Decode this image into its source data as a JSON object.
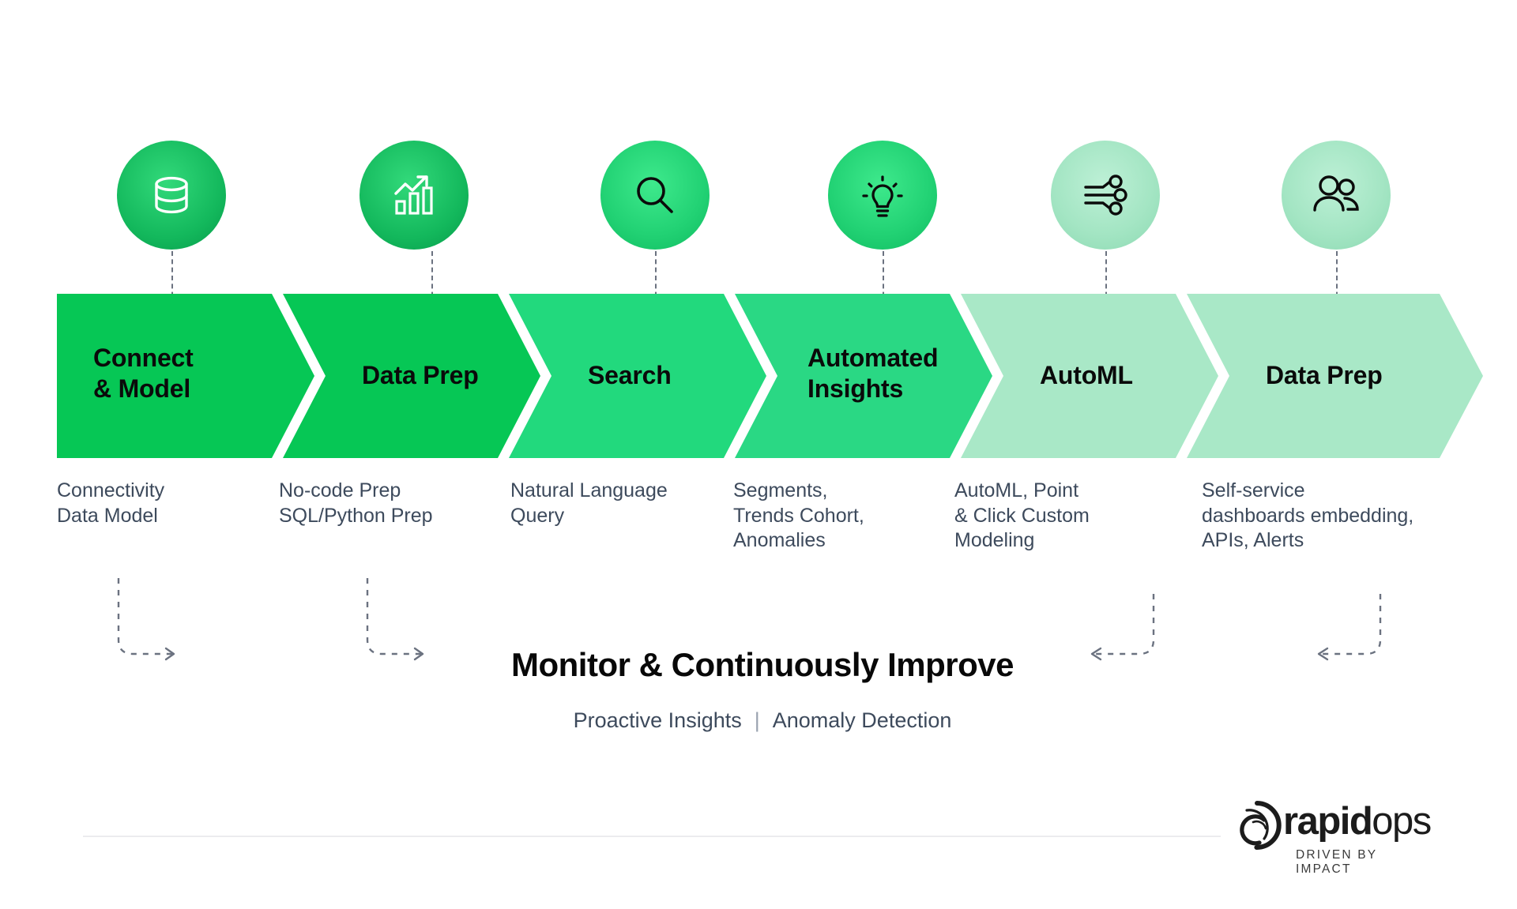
{
  "theme": {
    "green_dark": "#06c755",
    "green_mid": "#2ed47e",
    "green_light": "#a8e6c4",
    "green_pale": "#a9e8c7",
    "caption_color": "#3d4a5c",
    "arrow_color": "#6b7280",
    "divider_color": "#ececee"
  },
  "icons": [
    {
      "name": "database-icon",
      "stroke": "#ffffff",
      "circle_from": "#26d06e",
      "circle_to": "#0aa44b"
    },
    {
      "name": "bar-chart-growth-icon",
      "stroke": "#ffffff",
      "circle_from": "#2bd873",
      "circle_to": "#0aa44b"
    },
    {
      "name": "search-icon",
      "stroke": "#0b0b0b",
      "circle_from": "#3ce589",
      "circle_to": "#17c265"
    },
    {
      "name": "lightbulb-idea-icon",
      "stroke": "#0b0b0b",
      "circle_from": "#3ce589",
      "circle_to": "#17c265"
    },
    {
      "name": "model-nodes-icon",
      "stroke": "#0b0b0b",
      "circle_from": "#b6ecd0",
      "circle_to": "#8fdcb5"
    },
    {
      "name": "people-icon",
      "stroke": "#0b0b0b",
      "circle_from": "#b6ecd0",
      "circle_to": "#8fdcb5"
    }
  ],
  "stages": [
    {
      "label": "Connect\n& Model",
      "color": "#06c755",
      "caption": "Connectivity\nData Model"
    },
    {
      "label": "Data Prep",
      "color": "#06c755",
      "caption": "No-code Prep\nSQL/Python Prep"
    },
    {
      "label": "Search",
      "color": "#22d97d",
      "caption": "Natural Language\nQuery"
    },
    {
      "label": "Automated\nInsights",
      "color": "#2ad884",
      "caption": "Segments,\nTrends Cohort,\nAnomalies"
    },
    {
      "label": "AutoML",
      "color": "#a9e8c7",
      "caption": "AutoML, Point\n& Click Custom\nModeling"
    },
    {
      "label": "Data Prep",
      "color": "#a9e8c7",
      "caption": "Self-service\ndashboards embedding,\nAPIs, Alerts"
    }
  ],
  "monitor": {
    "title": "Monitor & Continuously Improve",
    "sub_left": "Proactive Insights",
    "separator": "|",
    "sub_right": "Anomaly Detection"
  },
  "logo": {
    "bold_part": "rapid",
    "light_part": "ops",
    "tagline": "DRIVEN BY IMPACT"
  }
}
